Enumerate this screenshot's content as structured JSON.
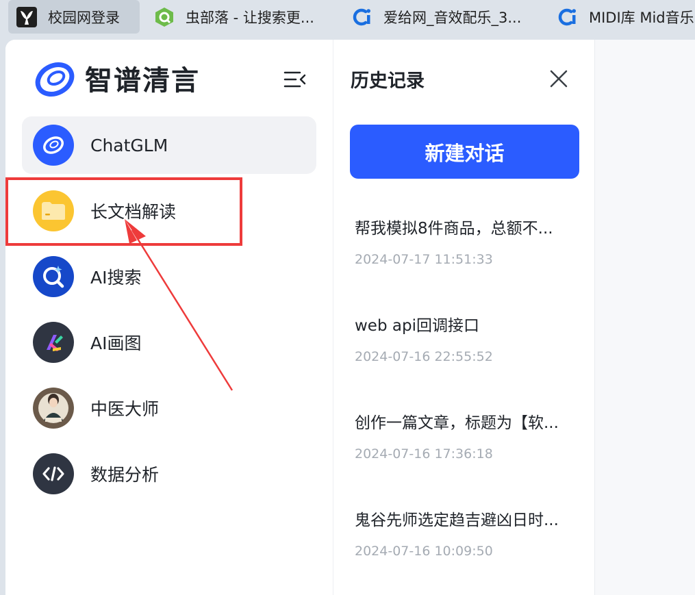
{
  "bookmarks": [
    {
      "label": "校园网登录",
      "icon": "butterfly-icon"
    },
    {
      "label": "虫部落 - 让搜索更...",
      "icon": "green-leaf-icon"
    },
    {
      "label": "爱给网_音效配乐_3...",
      "icon": "blue-ci-icon"
    },
    {
      "label": "MIDI库 Mid音乐",
      "icon": "blue-ci-icon"
    }
  ],
  "sidebar": {
    "logo_text": "智谱清言",
    "items": [
      {
        "label": "ChatGLM",
        "icon": "chatglm-icon",
        "selected": true
      },
      {
        "label": "长文档解读",
        "icon": "folder-icon"
      },
      {
        "label": "AI搜索",
        "icon": "search-icon"
      },
      {
        "label": "AI画图",
        "icon": "paint-icon"
      },
      {
        "label": "中医大师",
        "icon": "tcm-avatar-icon"
      },
      {
        "label": "数据分析",
        "icon": "code-icon"
      }
    ]
  },
  "history": {
    "title": "历史记录",
    "new_chat_label": "新建对话",
    "items": [
      {
        "title": "帮我模拟8件商品，总额不...",
        "date": "2024-07-17 11:51:33"
      },
      {
        "title": "web api回调接口",
        "date": "2024-07-16 22:55:52"
      },
      {
        "title": "创作一篇文章，标题为【软...",
        "date": "2024-07-16 17:36:18"
      },
      {
        "title": "鬼谷先师选定趋吉避凶日时...",
        "date": "2024-07-16 10:09:50"
      }
    ]
  },
  "colors": {
    "accent": "#2b5cff",
    "annotation": "#ee3b3b"
  }
}
